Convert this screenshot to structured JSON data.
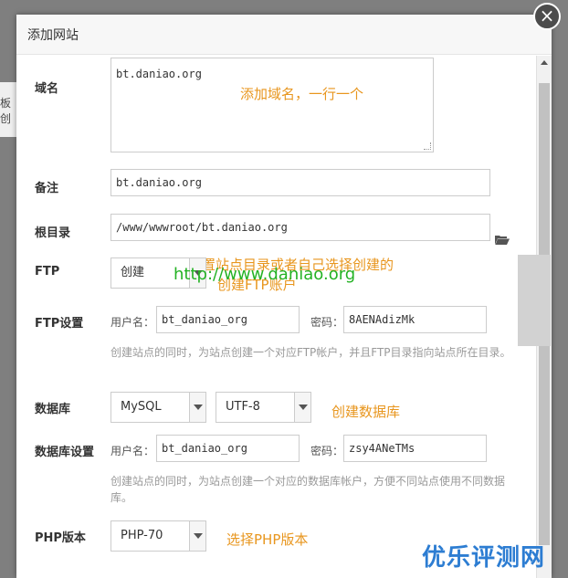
{
  "background": {
    "partial_text": "板创"
  },
  "dialog": {
    "title": "添加网站",
    "close_glyph": "×"
  },
  "form": {
    "domain": {
      "label": "域名",
      "value": "bt.daniao.org"
    },
    "remark": {
      "label": "备注",
      "value": "bt.daniao.org"
    },
    "root": {
      "label": "根目录",
      "value": "/www/wwwroot/bt.daniao.org"
    },
    "ftp": {
      "label": "FTP",
      "value": "创建"
    },
    "ftp_settings": {
      "label": "FTP设置",
      "username_label": "用户名：",
      "username": "bt_daniao_org",
      "password_label": "密码：",
      "password": "8AENAdizMk",
      "help": "创建站点的同时，为站点创建一个对应FTP帐户，并且FTP目录指向站点所在目录。"
    },
    "database": {
      "label": "数据库",
      "type": "MySQL",
      "charset": "UTF-8"
    },
    "db_settings": {
      "label": "数据库设置",
      "username_label": "用户名：",
      "username": "bt_daniao_org",
      "password_label": "密码：",
      "password": "zsy4ANeTMs",
      "help": "创建站点的同时，为站点创建一个对应的数据库帐户，方便不同站点使用不同数据库。"
    },
    "php": {
      "label": "PHP版本",
      "value": "PHP-70"
    }
  },
  "annotations": {
    "domain_note": "添加域名，一行一个",
    "root_note": "自动设置站点目录或者自己选择创建的",
    "ftp_note": "创建FTP账户",
    "db_note": "创建数据库",
    "php_note": "选择PHP版本"
  },
  "watermark": "http://www.daniao.org",
  "brand": "优乐评测网",
  "icons": {
    "close": "close-icon",
    "folder": "folder-open-icon",
    "dropdown": "chevron-down-icon"
  },
  "colors": {
    "annotation": "#e8961e",
    "watermark": "#24b224",
    "brand": "#2d7dd2"
  }
}
